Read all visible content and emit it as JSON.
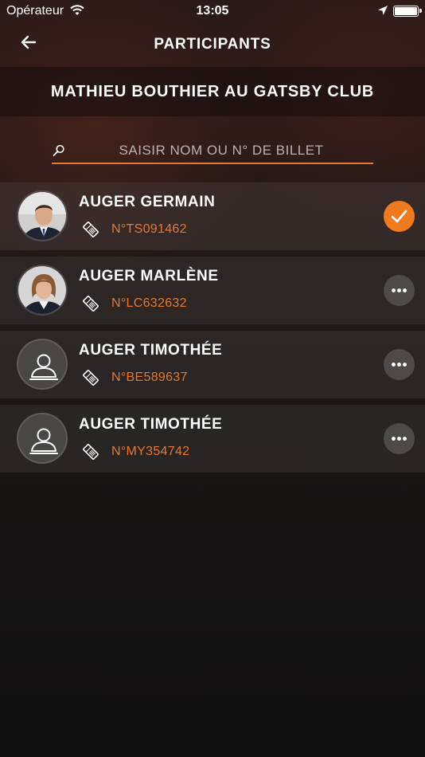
{
  "status_bar": {
    "carrier": "Opérateur",
    "time": "13:05",
    "icons": [
      "wifi-icon",
      "location-arrow-icon",
      "battery-icon"
    ]
  },
  "nav": {
    "title": "PARTICIPANTS",
    "back_icon": "arrow-left-icon"
  },
  "event": {
    "title": "MATHIEU BOUTHIER AU GATSBY CLUB"
  },
  "search": {
    "placeholder": "SAISIR NOM OU N° DE BILLET",
    "value": "",
    "icon": "search-icon"
  },
  "colors": {
    "accent": "#f07a1e",
    "ticket_text": "#e8772e"
  },
  "participants": [
    {
      "name": "AUGER GERMAIN",
      "ticket": "N°TS091462",
      "avatar": "photo-man",
      "checked_in": true,
      "action_icon": "check-icon"
    },
    {
      "name": "AUGER MARLÈNE",
      "ticket": "N°LC632632",
      "avatar": "photo-woman",
      "checked_in": false,
      "action_icon": "more-icon"
    },
    {
      "name": "AUGER TIMOTHÉE",
      "ticket": "N°BE589637",
      "avatar": "user-placeholder-icon",
      "checked_in": false,
      "action_icon": "more-icon"
    },
    {
      "name": "AUGER TIMOTHÉE",
      "ticket": "N°MY354742",
      "avatar": "user-placeholder-icon",
      "checked_in": false,
      "action_icon": "more-icon"
    }
  ]
}
